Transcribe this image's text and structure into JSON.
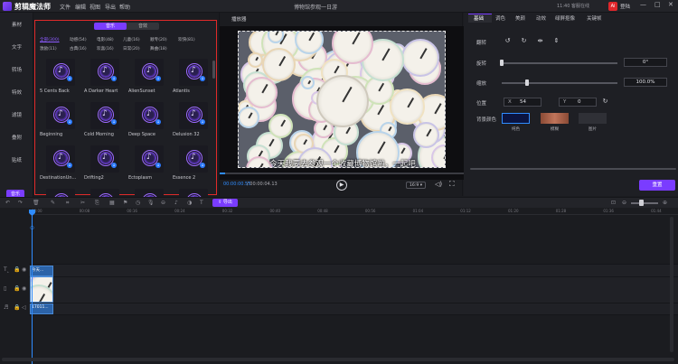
{
  "app": {
    "name": "剪辑魔法师",
    "window_title": "博物馆参观一日游",
    "menus": [
      "文件",
      "编辑",
      "视图",
      "导出",
      "帮助"
    ],
    "clock": "11:40 客服在线",
    "user_avatar": "Ai",
    "user_label": "登陆",
    "window_controls": [
      "—",
      "□",
      "✕"
    ]
  },
  "left_nav": {
    "items": [
      "素材",
      "文字",
      "转场",
      "特效",
      "滤镜",
      "叠附",
      "贴纸"
    ],
    "active_label": "音乐"
  },
  "media": {
    "tabs": [
      "音乐",
      "音效"
    ],
    "active_tab": "音乐",
    "categories_row1": [
      "全部(300)",
      "动感(54)",
      "电影(48)",
      "儿童(16)",
      "顺专(20)",
      "欢快(81)"
    ],
    "categories_row2": [
      "激励(11)",
      "古典(16)",
      "欢喜(16)",
      "日常(20)",
      "舞曲(18)"
    ],
    "active_category": "全部(300)",
    "tracks": [
      "5 Cents Back",
      "A Darker Heart",
      "AlienSunset",
      "Atlantis",
      "Beginning",
      "Cold Morning",
      "Deep Space",
      "Delusion 32",
      "DestinationUn...",
      "Drifting2",
      "Ectoplasm",
      "Essence 2",
      "",
      "",
      "",
      ""
    ]
  },
  "player": {
    "label": "播放器",
    "subtitle": "今天我要去参观一个收藏博物馆啦，一起吧",
    "time_current": "00:00:00.55",
    "time_total": "/ 00:00:04.13",
    "progress": 0.022,
    "play_icon": "play-icon",
    "aspect_ratio": "16:9"
  },
  "properties": {
    "tabs": [
      "基础",
      "调色",
      "美颜",
      "动效",
      "绿屏抠像",
      "关键帧"
    ],
    "active_tab": "基础",
    "flip_label": "翻转",
    "rotate_label": "旋转",
    "rotate_value": "0°",
    "rotate_level": 0.0,
    "scale_label": "缩放",
    "scale_value": "100.0%",
    "scale_level": 0.22,
    "position_label": "位置",
    "x_label": "X",
    "x_value": "54",
    "y_label": "Y",
    "y_value": "0",
    "bg_label": "背景颜色",
    "bg_options": [
      {
        "label": "纯色",
        "color": "#0b1440"
      },
      {
        "label": "模糊",
        "color": "#8a4a35"
      },
      {
        "label": "图片",
        "color": "#2f3036"
      }
    ],
    "reset_label": "重置"
  },
  "timeline": {
    "export_label": "导出",
    "ticks": [
      "00:00",
      "00:08",
      "00:16",
      "00:24",
      "00:32",
      "00:40",
      "00:48",
      "00:56",
      "01:04",
      "01:12",
      "01:20",
      "01:28",
      "01:36",
      "01:44"
    ],
    "text_clip": "今天...",
    "audio_clip": "17011..."
  },
  "colors": {
    "accent": "#7a3cff",
    "highlight": "#2f8cff",
    "selection_border": "#e02a2a"
  }
}
